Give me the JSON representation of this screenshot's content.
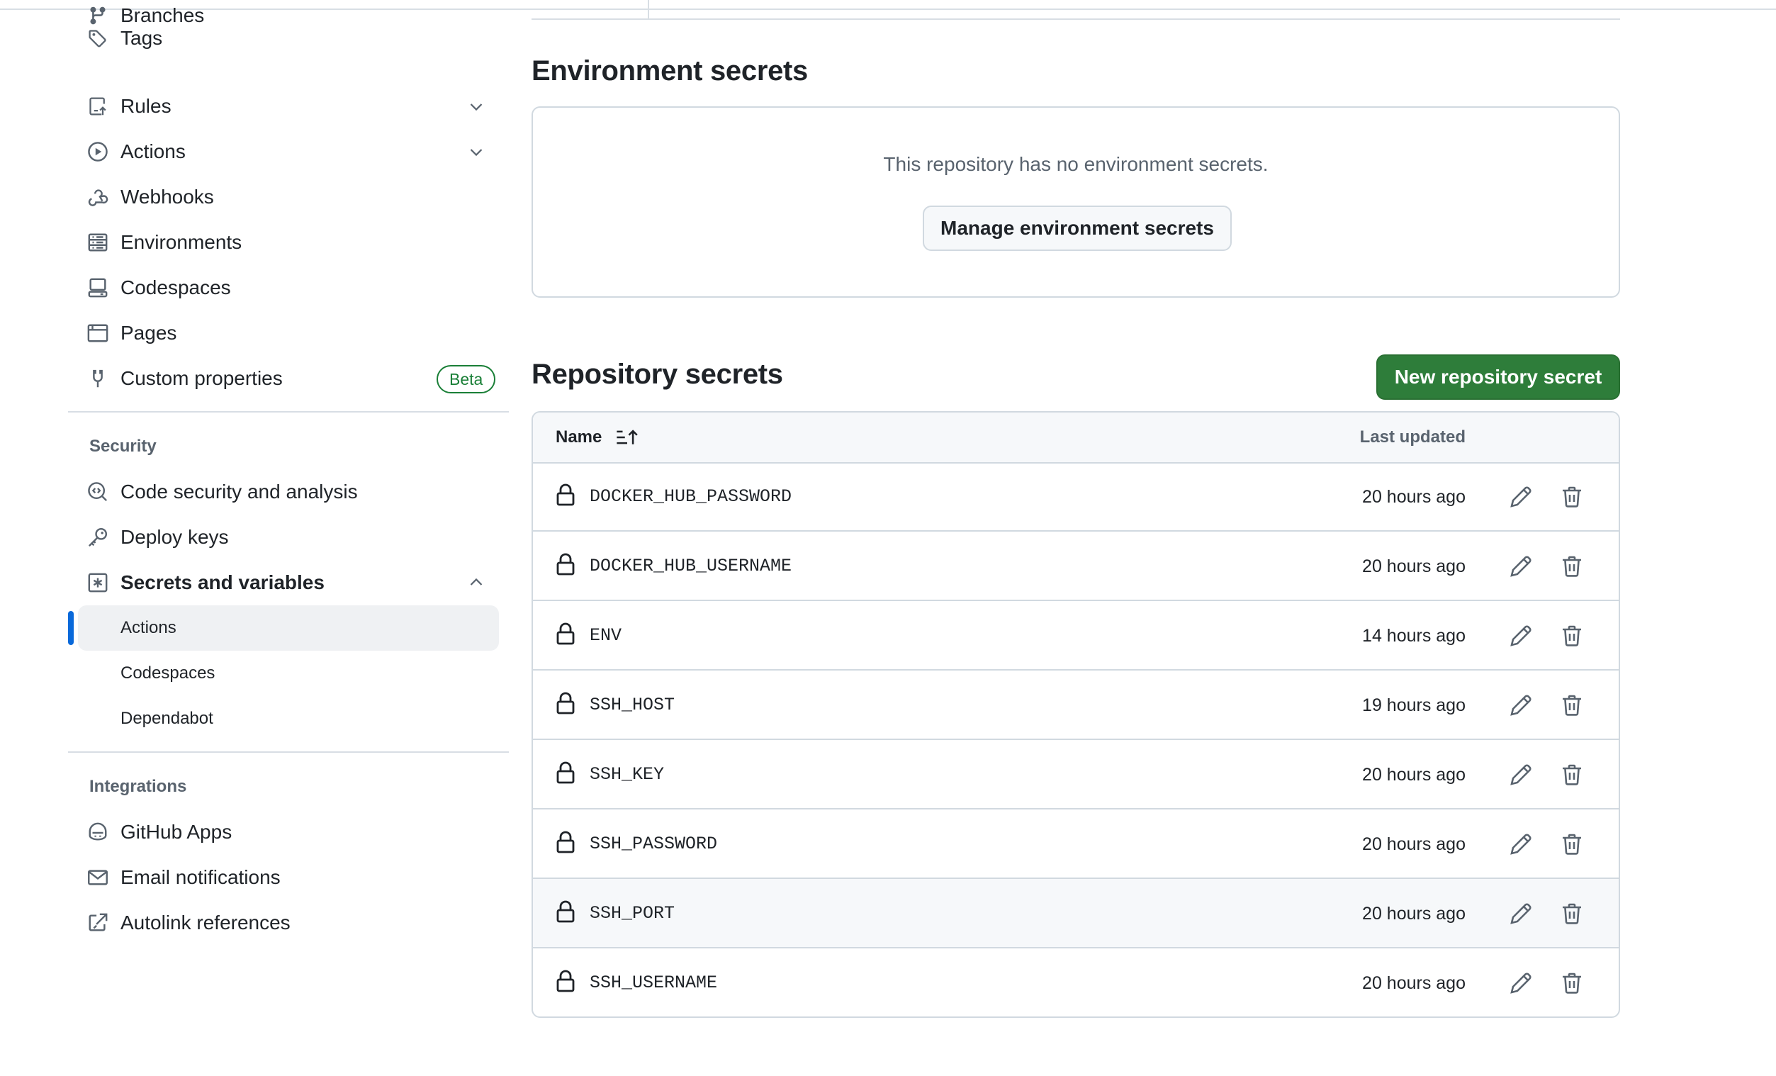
{
  "sidebar": {
    "items": [
      {
        "label": "Branches",
        "icon": "git-branch-icon"
      },
      {
        "label": "Tags",
        "icon": "tag-icon"
      },
      {
        "label": "Rules",
        "icon": "repo-push-icon"
      },
      {
        "label": "Actions",
        "icon": "play-icon"
      },
      {
        "label": "Webhooks",
        "icon": "webhook-icon"
      },
      {
        "label": "Environments",
        "icon": "server-icon"
      },
      {
        "label": "Codespaces",
        "icon": "codespaces-icon"
      },
      {
        "label": "Pages",
        "icon": "browser-icon"
      },
      {
        "label": "Custom properties",
        "icon": "note-icon",
        "badge": "Beta"
      }
    ],
    "security": {
      "title": "Security",
      "items": [
        {
          "label": "Code security and analysis",
          "icon": "codescan-icon"
        },
        {
          "label": "Deploy keys",
          "icon": "key-icon"
        },
        {
          "label": "Secrets and variables",
          "icon": "asterisk-icon"
        }
      ],
      "sub_items": [
        {
          "label": "Actions",
          "active": true
        },
        {
          "label": "Codespaces"
        },
        {
          "label": "Dependabot"
        }
      ]
    },
    "integrations": {
      "title": "Integrations",
      "items": [
        {
          "label": "GitHub Apps",
          "icon": "copilot-icon"
        },
        {
          "label": "Email notifications",
          "icon": "mail-icon"
        },
        {
          "label": "Autolink references",
          "icon": "link-external-icon"
        }
      ]
    }
  },
  "env_secrets": {
    "title": "Environment secrets",
    "empty_text": "This repository has no environment secrets.",
    "manage_button": "Manage environment secrets"
  },
  "repo_secrets": {
    "title": "Repository secrets",
    "new_button": "New repository secret",
    "columns": {
      "name": "Name",
      "updated": "Last updated"
    },
    "rows": [
      {
        "name": "DOCKER_HUB_PASSWORD",
        "updated": "20 hours ago"
      },
      {
        "name": "DOCKER_HUB_USERNAME",
        "updated": "20 hours ago"
      },
      {
        "name": "ENV",
        "updated": "14 hours ago"
      },
      {
        "name": "SSH_HOST",
        "updated": "19 hours ago"
      },
      {
        "name": "SSH_KEY",
        "updated": "20 hours ago"
      },
      {
        "name": "SSH_PASSWORD",
        "updated": "20 hours ago"
      },
      {
        "name": "SSH_PORT",
        "updated": "20 hours ago"
      },
      {
        "name": "SSH_USERNAME",
        "updated": "20 hours ago"
      }
    ]
  },
  "colors": {
    "primary_button": "#2e7d3a",
    "accent": "#0969da",
    "beta_badge": "#1a7f37"
  }
}
